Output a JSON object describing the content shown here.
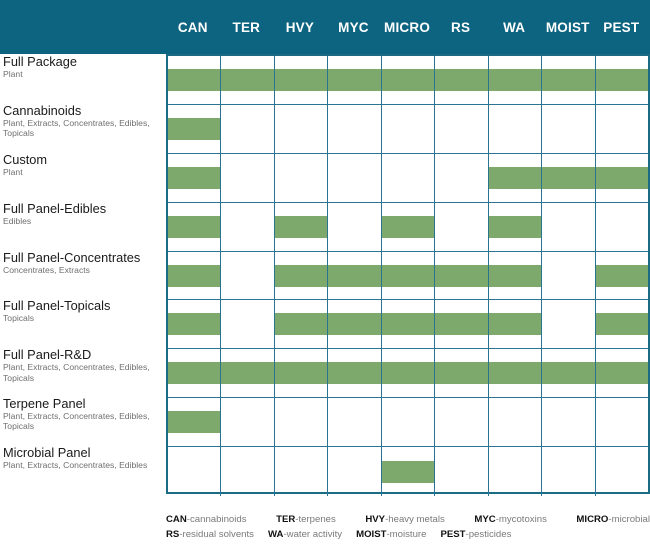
{
  "header": {
    "background_color": "#0d6480",
    "columns": [
      {
        "label": "CAN"
      },
      {
        "label": "TER"
      },
      {
        "label": "HVY"
      },
      {
        "label": "MYC"
      },
      {
        "label": "MICRO"
      },
      {
        "label": "RS"
      },
      {
        "label": "WA"
      },
      {
        "label": "MOIST"
      },
      {
        "label": "PEST"
      }
    ]
  },
  "colors": {
    "header_teal": "#0d6480",
    "grid_border": "#2b7491",
    "cell_fill_green": "#7da96c",
    "title_text": "#1a1a1a",
    "subtitle_text": "#6f6f6f",
    "legend_text": "#7a7a7a"
  },
  "rows": [
    {
      "title": "Full Package",
      "subtitle": "Plant",
      "cells": [
        true,
        true,
        true,
        true,
        true,
        true,
        true,
        true,
        true
      ]
    },
    {
      "title": "Cannabinoids",
      "subtitle": "Plant, Extracts, Concentrates, Edibles, Topicals",
      "cells": [
        true,
        false,
        false,
        false,
        false,
        false,
        false,
        false,
        false
      ]
    },
    {
      "title": "Custom",
      "subtitle": "Plant",
      "cells": [
        true,
        false,
        false,
        false,
        false,
        false,
        true,
        true,
        true
      ]
    },
    {
      "title": "Full Panel-Edibles",
      "subtitle": "Edibles",
      "cells": [
        true,
        false,
        true,
        false,
        true,
        false,
        true,
        false,
        false
      ]
    },
    {
      "title": "Full Panel-Concentrates",
      "subtitle": "Concentrates, Extracts",
      "cells": [
        true,
        false,
        true,
        true,
        true,
        true,
        true,
        false,
        true
      ]
    },
    {
      "title": "Full Panel-Topicals",
      "subtitle": "Topicals",
      "cells": [
        true,
        false,
        true,
        true,
        true,
        true,
        true,
        false,
        true
      ]
    },
    {
      "title": "Full Panel-R&D",
      "subtitle": "Plant, Extracts, Concentrates, Edibles, Topicals",
      "cells": [
        true,
        true,
        true,
        true,
        true,
        true,
        true,
        true,
        true
      ]
    },
    {
      "title": "Terpene Panel",
      "subtitle": "Plant, Extracts, Concentrates, Edibles, Topicals",
      "cells": [
        true,
        false,
        false,
        false,
        false,
        false,
        false,
        false,
        false
      ]
    },
    {
      "title": "Microbial Panel",
      "subtitle": "Plant, Extracts, Concentrates, Edibles",
      "cells": [
        false,
        false,
        false,
        false,
        true,
        false,
        false,
        false,
        false
      ]
    }
  ],
  "legend": {
    "line1": [
      {
        "abbr": "CAN",
        "desc": "-cannabinoids"
      },
      {
        "abbr": "TER",
        "desc": "-terpenes"
      },
      {
        "abbr": "HVY",
        "desc": "-heavy metals"
      },
      {
        "abbr": "MYC",
        "desc": "-mycotoxins"
      },
      {
        "abbr": "MICRO",
        "desc": "-microbial"
      }
    ],
    "line2": [
      {
        "abbr": "RS",
        "desc": "-residual solvents"
      },
      {
        "abbr": "WA",
        "desc": "-water activity"
      },
      {
        "abbr": "MOIST",
        "desc": "-moisture"
      },
      {
        "abbr": "PEST",
        "desc": "-pesticides"
      }
    ]
  }
}
